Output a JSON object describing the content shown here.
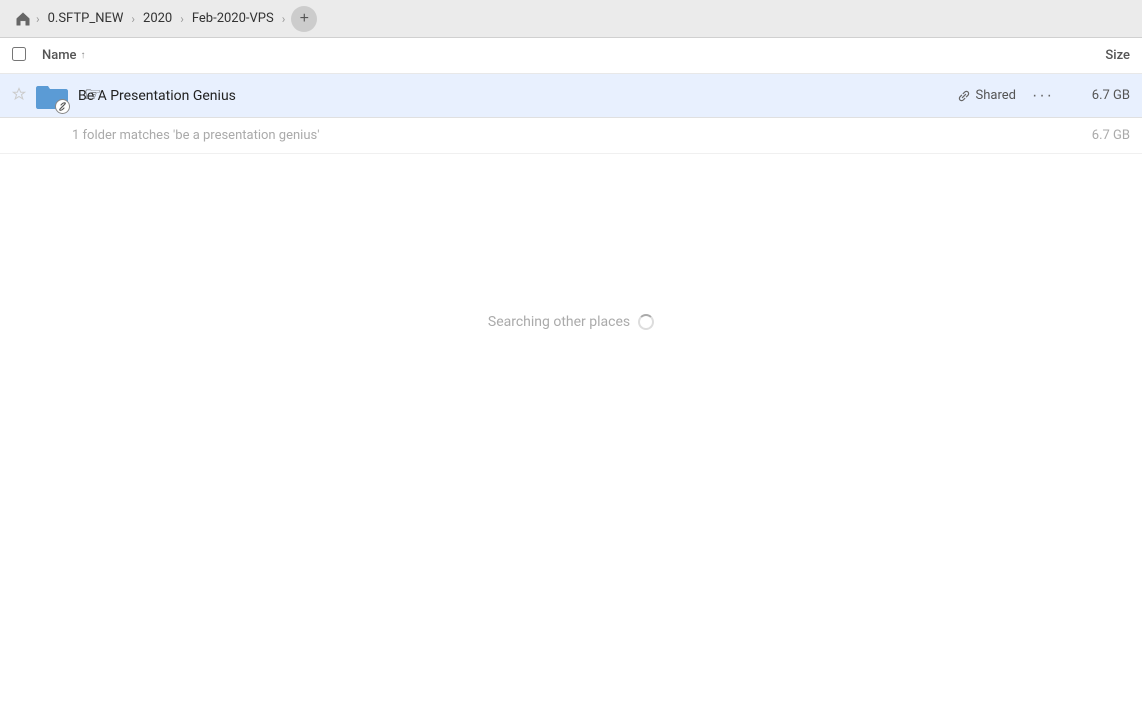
{
  "toolbar": {
    "home_icon": "⌂",
    "breadcrumb": [
      {
        "label": "0.SFTP_NEW"
      },
      {
        "label": "2020"
      },
      {
        "label": "Feb-2020-VPS"
      }
    ],
    "add_button_label": "+"
  },
  "list": {
    "header": {
      "name_label": "Name",
      "sort_indicator": "↑",
      "size_label": "Size"
    },
    "items": [
      {
        "name": "Be A Presentation Genius",
        "shared_label": "Shared",
        "size": "6.7 GB",
        "is_starred": false,
        "has_link": true
      }
    ],
    "match_text": "1 folder matches 'be a presentation genius'",
    "match_size": "6.7 GB",
    "searching_text": "Searching other places"
  }
}
